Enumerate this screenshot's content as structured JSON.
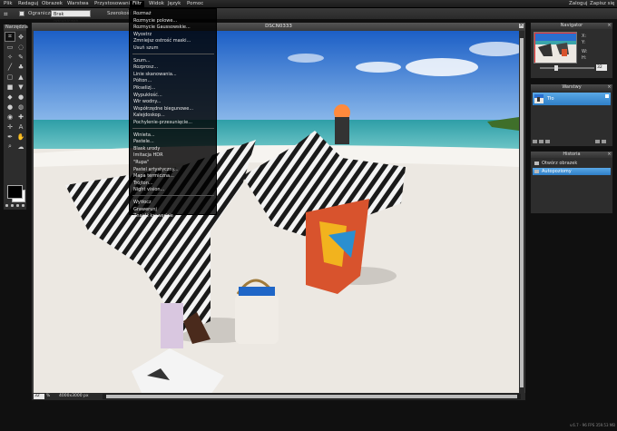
{
  "menubar": {
    "items": [
      "Plik",
      "Redaguj",
      "Obrazek",
      "Warstwa",
      "Przystosowanie",
      "Filtr",
      "Widok",
      "Język",
      "Pomoc"
    ],
    "active": "Filtr",
    "right_login": "Zaloguj",
    "right_signup": "Zapisz się"
  },
  "optbar": {
    "icon": "crop-icon",
    "constraint_label": "Ograniczenie:",
    "constraint_value": "Brak ograniczeń",
    "width_label": "Szerokość:"
  },
  "tools_panel": {
    "title": "Narzędzia",
    "tools": [
      "crop-icon",
      "move-icon",
      "select-rect-icon",
      "lasso-icon",
      "wand-icon",
      "pencil-icon",
      "brush-icon",
      "clone-icon",
      "eraser-icon",
      "fill-icon",
      "gradient-icon",
      "blur-icon",
      "sharpen-icon",
      "dodge-icon",
      "burn-icon",
      "sponge-icon",
      "redeye-icon",
      "heal-icon",
      "pin-icon",
      "text-icon",
      "eyedropper-icon",
      "hand-icon",
      "zoom-icon",
      "smudge-icon"
    ],
    "glyphs": [
      "⌗",
      "✥",
      "▭",
      "◌",
      "✧",
      "✎",
      "╱",
      "♣",
      "▢",
      "▲",
      "■",
      "▼",
      "◆",
      "●",
      "●",
      "◍",
      "◉",
      "✚",
      "✛",
      "A",
      "✒",
      "✋",
      "⌕",
      "☁"
    ]
  },
  "canvas": {
    "title": "DSCN0333",
    "zoom": "32",
    "zoom_unit": "%",
    "dimensions": "4000x3000 px"
  },
  "filter_menu": {
    "items": [
      "Rozmaż",
      "Rozmycie polowe...",
      "Rozmycie Gaussowskie...",
      "Wyostrz",
      "Zmniejsz ostrość maski...",
      "Usuń szum",
      "Szum...",
      "Rozprosz...",
      "Linie skanowania...",
      "Pólton...",
      "Pikselizj...",
      "Wypukłość...",
      "Wir wodny...",
      "Współrzędne biegunowe...",
      "Kalejdoskop...",
      "Pochylenie-przesunięcie...",
      "Winieta...",
      "Pastele...",
      "Blask urody",
      "Imitacja HDR",
      "\"Rupa\"",
      "Pastel artystyczny...",
      "Mapa termiczna...",
      "Trójton...",
      "Night vision...",
      "Wytłocz",
      "Grawerunj",
      "Znajdź krawędzie"
    ]
  },
  "navigator": {
    "title": "Navigator",
    "x_label": "X:",
    "y_label": "Y:",
    "w_label": "W:",
    "h_label": "H:",
    "zoom": "32"
  },
  "layers": {
    "title": "Warstwy",
    "items": [
      {
        "name": "Tło"
      }
    ]
  },
  "history": {
    "title": "Historia",
    "items": [
      {
        "name": "Otwórz obrazek",
        "selected": false
      },
      {
        "name": "Autopoziomy",
        "selected": true
      }
    ]
  },
  "footer": {
    "version": "v.6.7 - 96 FPS 359.53 MB"
  },
  "colors": {
    "accent": "#3a8fd6",
    "chrome": "#2d2d2d",
    "canvas_bg": "#3a3a3a"
  }
}
